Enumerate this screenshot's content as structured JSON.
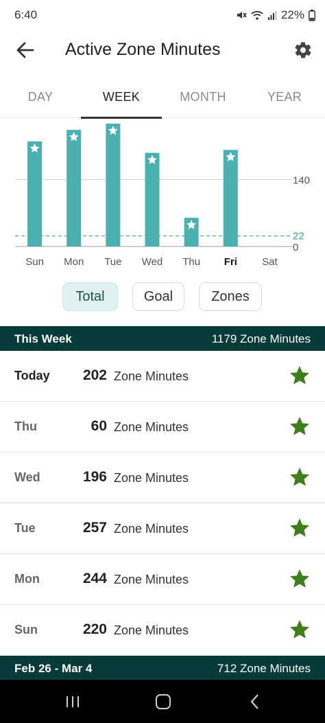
{
  "status": {
    "time": "6:40",
    "battery": "22%",
    "icons": [
      "mute-icon",
      "wifi-icon",
      "signal-icon",
      "battery-icon"
    ]
  },
  "header": {
    "title": "Active Zone Minutes",
    "back_icon": "arrow-back-icon",
    "settings_icon": "gear-icon"
  },
  "tabs": [
    {
      "label": "DAY",
      "active": false
    },
    {
      "label": "WEEK",
      "active": true
    },
    {
      "label": "MONTH",
      "active": false
    },
    {
      "label": "YEAR",
      "active": false
    }
  ],
  "chart_data": {
    "type": "bar",
    "categories": [
      "Sun",
      "Mon",
      "Tue",
      "Wed",
      "Thu",
      "Fri",
      "Sat"
    ],
    "values": [
      220,
      244,
      257,
      196,
      60,
      202,
      0
    ],
    "goal_met": [
      true,
      true,
      true,
      true,
      true,
      true,
      false
    ],
    "highlight_category": "Fri",
    "goal_line": 22,
    "yticks": [
      0,
      140
    ],
    "goal_label": "22",
    "ylim": [
      0,
      260
    ],
    "grid": true,
    "bar_color": "#4ab1b0",
    "goal_line_color": "#2fa39a"
  },
  "chips": [
    {
      "label": "Total",
      "selected": true
    },
    {
      "label": "Goal",
      "selected": false
    },
    {
      "label": "Zones",
      "selected": false
    }
  ],
  "this_week": {
    "label": "This Week",
    "total": "1179 Zone Minutes"
  },
  "days": [
    {
      "label": "Today",
      "value": "202",
      "unit": "Zone Minutes",
      "star": true
    },
    {
      "label": "Thu",
      "value": "60",
      "unit": "Zone Minutes",
      "star": true
    },
    {
      "label": "Wed",
      "value": "196",
      "unit": "Zone Minutes",
      "star": true
    },
    {
      "label": "Tue",
      "value": "257",
      "unit": "Zone Minutes",
      "star": true
    },
    {
      "label": "Mon",
      "value": "244",
      "unit": "Zone Minutes",
      "star": true
    },
    {
      "label": "Sun",
      "value": "220",
      "unit": "Zone Minutes",
      "star": true
    }
  ],
  "prev_week": {
    "label": "Feb 26 - Mar 4",
    "total": "712 Zone Minutes"
  },
  "colors": {
    "header_dark": "#073b3a",
    "star_green": "#3f7f1c",
    "chip_selected_bg": "#dff1f1"
  },
  "nav": [
    "recents-icon",
    "home-icon",
    "back-icon"
  ]
}
